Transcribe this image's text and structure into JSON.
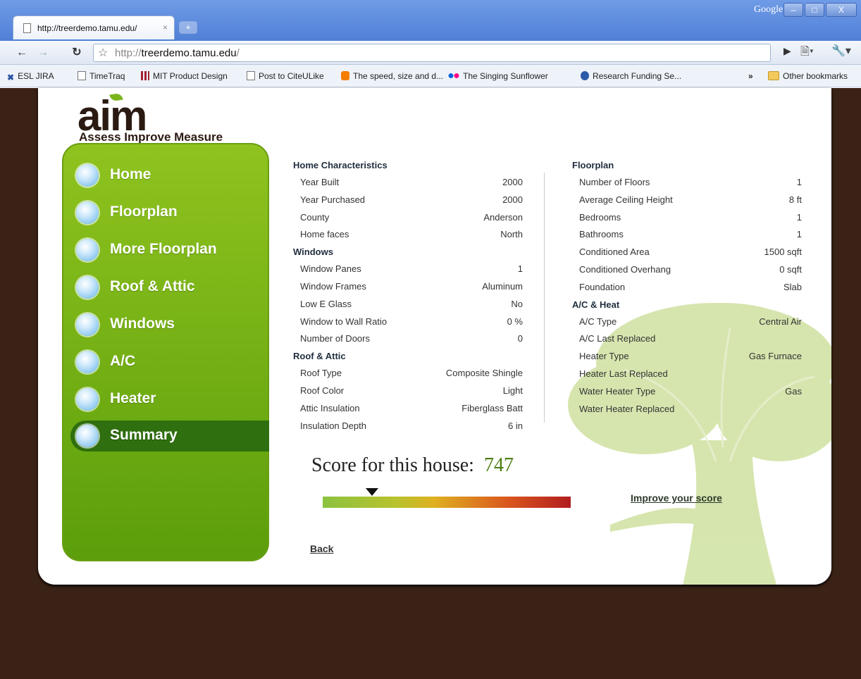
{
  "browser": {
    "tab_title": "http://treerdemo.tamu.edu/",
    "tab_close": "×",
    "new_tab": "+",
    "url_prefix": "http://",
    "url_host": "treerdemo.tamu.edu",
    "url_suffix": "/",
    "search_label": "Google",
    "window_controls": {
      "minimize": "–",
      "maximize": "□",
      "close": "X"
    },
    "bookmarks": [
      {
        "label": "ESL JIRA",
        "icon": "jira-icon"
      },
      {
        "label": "TimeTraq",
        "icon": "page-icon"
      },
      {
        "label": "MIT Product Design",
        "icon": "mit-icon"
      },
      {
        "label": "Post to CiteULike",
        "icon": "page-icon"
      },
      {
        "label": "The speed, size and d...",
        "icon": "blogger-icon"
      },
      {
        "label": "The Singing Sunflower",
        "icon": "flickr-icon"
      },
      {
        "label": "Research Funding Se...",
        "icon": "info-icon"
      },
      {
        "label": "Other bookmarks",
        "icon": "folder-icon"
      }
    ],
    "overflow": "»"
  },
  "logo": {
    "text": "aim",
    "tagline": "Assess Improve Measure"
  },
  "nav": [
    {
      "label": "Home"
    },
    {
      "label": "Floorplan"
    },
    {
      "label": "More Floorplan"
    },
    {
      "label": "Roof & Attic"
    },
    {
      "label": "Windows"
    },
    {
      "label": "A/C"
    },
    {
      "label": "Heater"
    },
    {
      "label": "Summary",
      "active": true
    }
  ],
  "summary": {
    "left": [
      {
        "title": "Home Characteristics",
        "rows": [
          {
            "label": "Year Built",
            "value": "2000"
          },
          {
            "label": "Year Purchased",
            "value": "2000"
          },
          {
            "label": "County",
            "value": "Anderson"
          },
          {
            "label": "Home faces",
            "value": "North"
          }
        ]
      },
      {
        "title": "Windows",
        "rows": [
          {
            "label": "Window Panes",
            "value": "1"
          },
          {
            "label": "Window Frames",
            "value": "Aluminum"
          },
          {
            "label": "Low E Glass",
            "value": "No"
          },
          {
            "label": "Window to Wall Ratio",
            "value": "0 %"
          },
          {
            "label": "Number of Doors",
            "value": "0"
          }
        ]
      },
      {
        "title": "Roof & Attic",
        "rows": [
          {
            "label": "Roof Type",
            "value": "Composite Shingle"
          },
          {
            "label": "Roof Color",
            "value": "Light"
          },
          {
            "label": "Attic Insulation",
            "value": "Fiberglass Batt"
          },
          {
            "label": "Insulation Depth",
            "value": "6 in"
          }
        ]
      }
    ],
    "right": [
      {
        "title": "Floorplan",
        "rows": [
          {
            "label": "Number of Floors",
            "value": "1"
          },
          {
            "label": "Average Ceiling Height",
            "value": "8 ft"
          },
          {
            "label": "Bedrooms",
            "value": "1"
          },
          {
            "label": "Bathrooms",
            "value": "1"
          },
          {
            "label": "Conditioned Area",
            "value": "1500 sqft"
          },
          {
            "label": "Conditioned Overhang",
            "value": "0 sqft"
          },
          {
            "label": "Foundation",
            "value": "Slab"
          }
        ]
      },
      {
        "title": "A/C & Heat",
        "rows": [
          {
            "label": "A/C Type",
            "value": "Central Air"
          },
          {
            "label": "A/C Last Replaced",
            "value": ""
          },
          {
            "label": "Heater Type",
            "value": "Gas Furnace"
          },
          {
            "label": "Heater Last Replaced",
            "value": ""
          },
          {
            "label": "Water Heater Type",
            "value": "Gas"
          },
          {
            "label": "Water Heater Replaced",
            "value": ""
          }
        ]
      }
    ]
  },
  "score": {
    "label": "Score for this house:",
    "value": "747",
    "marker_fraction": 0.2,
    "improve_link": "Improve your score"
  },
  "back_link": "Back",
  "colors": {
    "sidebar": "#7cb518",
    "active_nav": "#2f6f0f",
    "background": "#3b2216",
    "score": "#4d7d12"
  }
}
